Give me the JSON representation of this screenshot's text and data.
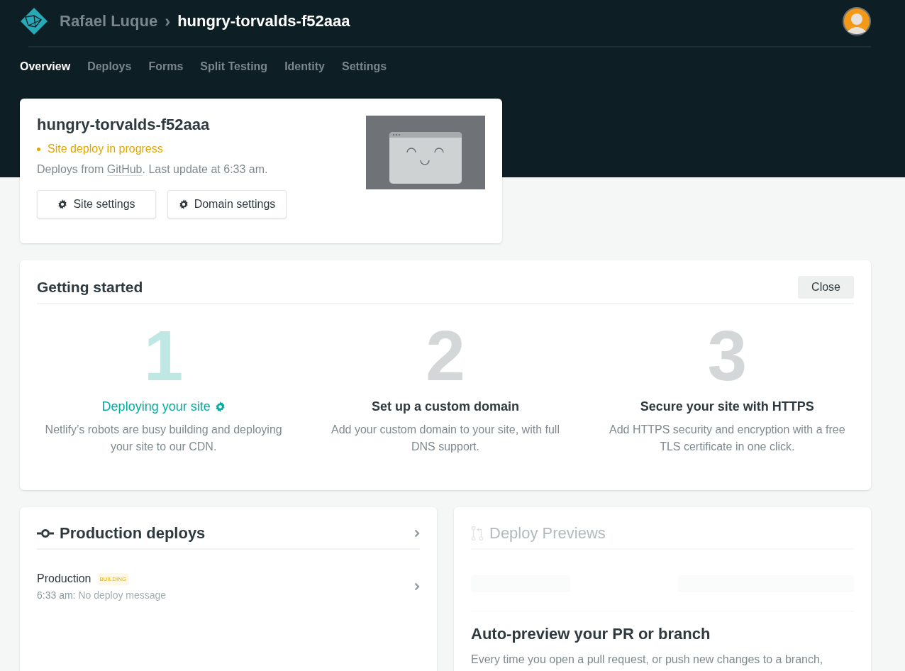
{
  "header": {
    "team": "Rafael Luque",
    "separator": "›",
    "site": "hungry-torvalds-f52aaa"
  },
  "nav": [
    {
      "label": "Overview",
      "selected": true
    },
    {
      "label": "Deploys",
      "selected": false
    },
    {
      "label": "Forms",
      "selected": false
    },
    {
      "label": "Split Testing",
      "selected": false
    },
    {
      "label": "Identity",
      "selected": false
    },
    {
      "label": "Settings",
      "selected": false
    }
  ],
  "site_card": {
    "title": "hungry-torvalds-f52aaa",
    "status": "Site deploy in progress",
    "source_prefix": "Deploys from ",
    "source_link": "GitHub",
    "source_suffix": ". Last update at 6:33 am.",
    "buttons": [
      "Site settings",
      "Domain settings"
    ]
  },
  "getting_started": {
    "title": "Getting started",
    "close": "Close",
    "steps": [
      {
        "number": "1",
        "title": "Deploying your site",
        "text": "Netlify’s robots are busy building and deploying your site to our CDN.",
        "active": true
      },
      {
        "number": "2",
        "title": "Set up a custom domain",
        "text": "Add your custom domain to your site, with full DNS support.",
        "active": false
      },
      {
        "number": "3",
        "title": "Secure your site with HTTPS",
        "text": "Add HTTPS security and encryption with a free TLS certificate in one click.",
        "active": false
      }
    ]
  },
  "production": {
    "title": "Production deploys",
    "deploys": [
      {
        "name": "Production",
        "badge": "BUILDING",
        "time": "6:33 am:",
        "message": "No deploy message"
      }
    ]
  },
  "previews": {
    "title": "Deploy Previews",
    "disabled": true,
    "heading": "Auto-preview your PR or branch",
    "text": "Every time you open a pull request, or push new changes to a branch,"
  }
}
